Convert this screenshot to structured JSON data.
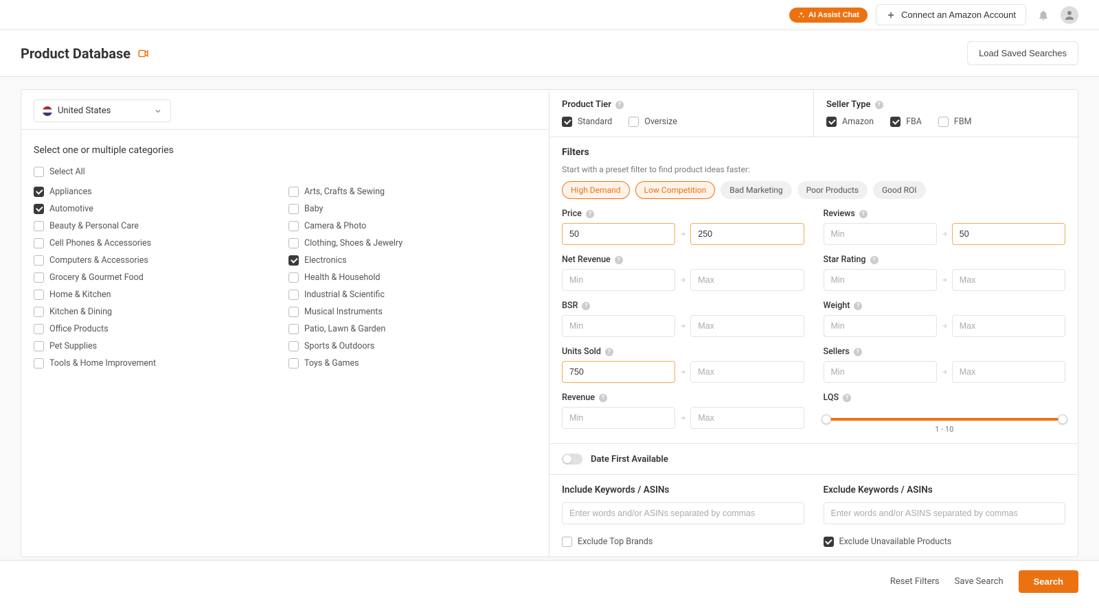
{
  "topbar": {
    "ai_chat": "AI Assist Chat",
    "connect": "Connect an Amazon Account"
  },
  "page": {
    "title": "Product Database",
    "load_saved": "Load Saved Searches"
  },
  "country": {
    "selected": "United States"
  },
  "categories": {
    "heading": "Select one or multiple categories",
    "select_all": "Select All",
    "left": [
      {
        "label": "Appliances",
        "checked": true
      },
      {
        "label": "Automotive",
        "checked": true
      },
      {
        "label": "Beauty & Personal Care",
        "checked": false
      },
      {
        "label": "Cell Phones & Accessories",
        "checked": false
      },
      {
        "label": "Computers & Accessories",
        "checked": false
      },
      {
        "label": "Grocery & Gourmet Food",
        "checked": false
      },
      {
        "label": "Home & Kitchen",
        "checked": false
      },
      {
        "label": "Kitchen & Dining",
        "checked": false
      },
      {
        "label": "Office Products",
        "checked": false
      },
      {
        "label": "Pet Supplies",
        "checked": false
      },
      {
        "label": "Tools & Home Improvement",
        "checked": false
      }
    ],
    "right": [
      {
        "label": "Arts, Crafts & Sewing",
        "checked": false
      },
      {
        "label": "Baby",
        "checked": false
      },
      {
        "label": "Camera & Photo",
        "checked": false
      },
      {
        "label": "Clothing, Shoes & Jewelry",
        "checked": false
      },
      {
        "label": "Electronics",
        "checked": true
      },
      {
        "label": "Health & Household",
        "checked": false
      },
      {
        "label": "Industrial & Scientific",
        "checked": false
      },
      {
        "label": "Musical Instruments",
        "checked": false
      },
      {
        "label": "Patio, Lawn & Garden",
        "checked": false
      },
      {
        "label": "Sports & Outdoors",
        "checked": false
      },
      {
        "label": "Toys & Games",
        "checked": false
      }
    ]
  },
  "product_tier": {
    "title": "Product Tier",
    "options": [
      {
        "label": "Standard",
        "checked": true
      },
      {
        "label": "Oversize",
        "checked": false
      }
    ]
  },
  "seller_type": {
    "title": "Seller Type",
    "options": [
      {
        "label": "Amazon",
        "checked": true
      },
      {
        "label": "FBA",
        "checked": true
      },
      {
        "label": "FBM",
        "checked": false
      }
    ]
  },
  "filters": {
    "title": "Filters",
    "hint": "Start with a preset filter to find product ideas faster:",
    "presets": [
      {
        "label": "High Demand",
        "active": true
      },
      {
        "label": "Low Competition",
        "active": true
      },
      {
        "label": "Bad Marketing",
        "active": false
      },
      {
        "label": "Poor Products",
        "active": false
      },
      {
        "label": "Good ROI",
        "active": false
      }
    ],
    "rows": {
      "price": {
        "label": "Price",
        "min": "50",
        "max": "250",
        "min_hi": true,
        "max_hi": true,
        "min_ph": "Min",
        "max_ph": "Max"
      },
      "reviews": {
        "label": "Reviews",
        "min": "",
        "max": "50",
        "min_hi": false,
        "max_hi": true,
        "min_ph": "Min",
        "max_ph": "Max"
      },
      "net_revenue": {
        "label": "Net Revenue",
        "min": "",
        "max": "",
        "min_hi": false,
        "max_hi": false,
        "min_ph": "Min",
        "max_ph": "Max"
      },
      "star_rating": {
        "label": "Star Rating",
        "min": "",
        "max": "",
        "min_hi": false,
        "max_hi": false,
        "min_ph": "Min",
        "max_ph": "Max"
      },
      "bsr": {
        "label": "BSR",
        "min": "",
        "max": "",
        "min_hi": false,
        "max_hi": false,
        "min_ph": "Min",
        "max_ph": "Max"
      },
      "weight": {
        "label": "Weight",
        "min": "",
        "max": "",
        "min_hi": false,
        "max_hi": false,
        "min_ph": "Min",
        "max_ph": "Max"
      },
      "units_sold": {
        "label": "Units Sold",
        "min": "750",
        "max": "",
        "min_hi": true,
        "max_hi": false,
        "min_ph": "Min",
        "max_ph": "Max"
      },
      "sellers": {
        "label": "Sellers",
        "min": "",
        "max": "",
        "min_hi": false,
        "max_hi": false,
        "min_ph": "Min",
        "max_ph": "Max"
      },
      "revenue": {
        "label": "Revenue",
        "min": "",
        "max": "",
        "min_hi": false,
        "max_hi": false,
        "min_ph": "Min",
        "max_ph": "Max"
      }
    },
    "lqs": {
      "label": "LQS",
      "range": "1   -   10"
    },
    "date_first": "Date First Available"
  },
  "keywords": {
    "include_label": "Include Keywords / ASINs",
    "exclude_label": "Exclude Keywords / ASINs",
    "include_ph": "Enter words and/or ASINs separated by commas",
    "exclude_ph": "Enter words and/or ASINS separated by commas",
    "exclude_top_brands": {
      "label": "Exclude Top Brands",
      "checked": false
    },
    "exclude_unavailable": {
      "label": "Exclude Unavailable Products",
      "checked": true
    }
  },
  "footer": {
    "reset": "Reset Filters",
    "save": "Save Search",
    "search": "Search"
  }
}
